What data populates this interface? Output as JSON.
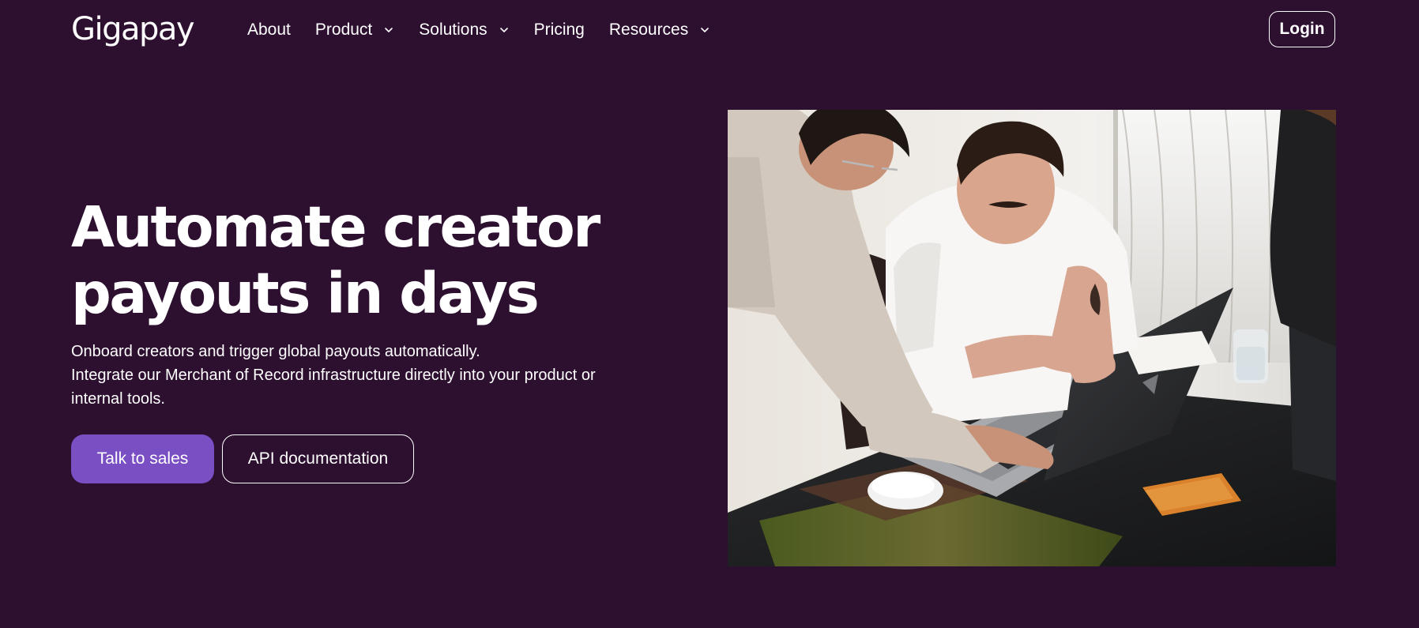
{
  "header": {
    "logo_text": "Gigapay",
    "nav": [
      {
        "label": "About",
        "has_dropdown": false
      },
      {
        "label": "Product",
        "has_dropdown": true
      },
      {
        "label": "Solutions",
        "has_dropdown": true
      },
      {
        "label": "Pricing",
        "has_dropdown": false
      },
      {
        "label": "Resources",
        "has_dropdown": true
      }
    ],
    "login_label": "Login",
    "dropdown_icon": "chevron-down-icon"
  },
  "hero": {
    "title_line1": "Automate creator",
    "title_line2": "payouts in days",
    "subtitle_line1": "Onboard creators and trigger global payouts automatically.",
    "subtitle_line2": "Integrate our Merchant of Record infrastructure directly into your product or",
    "subtitle_line3": "internal tools.",
    "primary_cta": "Talk to sales",
    "secondary_cta": "API documentation"
  },
  "colors": {
    "background": "#2d0f30",
    "primary_button": "#7a4fc4",
    "text": "#ffffff"
  }
}
